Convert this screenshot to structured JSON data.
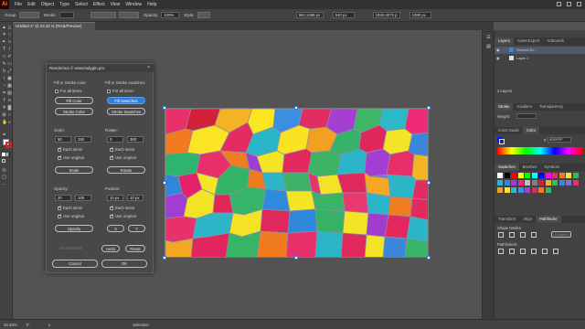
{
  "menubar": {
    "app_icon": "Ai",
    "items": [
      "File",
      "Edit",
      "Object",
      "Type",
      "Select",
      "Effect",
      "View",
      "Window",
      "Help"
    ]
  },
  "controlbar": {
    "selection_label": "Group",
    "stroke_label": "Stroke:",
    "opacity_label": "Opacity:",
    "opacity_value": "100%",
    "style_label": "Style:",
    "x_value": "963.1486 px",
    "y_value": "540 px",
    "w_value": "1920.0073 p",
    "h_value": "1080 px"
  },
  "document": {
    "tab_title": "Untitled-1* @ 33.33 % (RGB/Preview)"
  },
  "dialog": {
    "title": "Randomus © www.ladygin.pro",
    "close_glyph": "×",
    "fill_stroke_color_label": "Fill or Stroke color:",
    "fill_stroke_swatches_label": "Fill or Stroke swatches:",
    "for_all_items": "For all items",
    "fill_color": "Fill Color",
    "stroke_color": "Stroke Color",
    "fill_swatches": "Fill Swatches",
    "stroke_swatches": "Stroke Swatches",
    "scale_label": "Scale:",
    "scale_min": "50",
    "scale_max": "150",
    "rotate_label": "Rotate:",
    "rotate_min": "0",
    "rotate_max": "360",
    "each_items": "Each items",
    "use_original": "Use original",
    "scale_button": "Scale",
    "rotate_button": "Rotate",
    "opacity_label": "Opacity:",
    "opacity_min": "20",
    "opacity_max": "100",
    "position_label": "Position:",
    "pos_x": "10 px",
    "pos_y": "10 px",
    "opacity_button": "Opacity",
    "x_button": "X",
    "y_button": "Y",
    "undo": "Undo",
    "reset": "Reset",
    "cancel": "Cancel",
    "ok": "OK",
    "faded_label": "All selections"
  },
  "panels": {
    "layers_tabs": [
      "Layers",
      "Asset Export",
      "Artboards"
    ],
    "layer_names": [
      "Voronoi Di...",
      "Layer 1"
    ],
    "layers_count": "2 Layers",
    "transform_tabs": [
      "Stroke",
      "Gradient",
      "Transparency"
    ],
    "weight_label": "Weight:",
    "color_tabs": [
      "Color Guide",
      "Color"
    ],
    "hex_value": "0D0FFF",
    "swatches_tabs": [
      "Swatches",
      "Brushes",
      "Symbols"
    ],
    "bottom_tabs": [
      "Transform",
      "Align",
      "Pathfinder"
    ],
    "shape_modes": "Shape Modes:",
    "expand": "Expand",
    "pathfinders": "Pathfinders:"
  },
  "statusbar": {
    "zoom": "33.33%",
    "rotation": "0°",
    "artboard": "1",
    "tool": "Selection"
  }
}
